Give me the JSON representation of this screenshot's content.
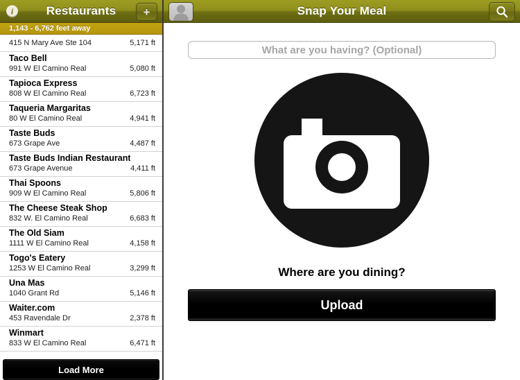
{
  "left_panel": {
    "navbar": {
      "title": "Restaurants",
      "info_icon_glyph": "i",
      "add_button_label": "+"
    },
    "section_header": "1,143 - 6,762 feet away",
    "rows": [
      {
        "title": "",
        "address": "415 N Mary Ave Ste 104",
        "distance": "5,171 ft"
      },
      {
        "title": "Taco Bell",
        "address": "991 W El Camino Real",
        "distance": "5,080 ft"
      },
      {
        "title": "Tapioca Express",
        "address": "808 W El Camino Real",
        "distance": "6,723 ft"
      },
      {
        "title": "Taqueria Margaritas",
        "address": "80 W El Camino Real",
        "distance": "4,941 ft"
      },
      {
        "title": "Taste Buds",
        "address": "673 Grape Ave",
        "distance": "4,487 ft"
      },
      {
        "title": "Taste Buds Indian Restaurant",
        "address": "673 Grape Avenue",
        "distance": "4,411 ft"
      },
      {
        "title": "Thai Spoons",
        "address": "909 W El Camino Real",
        "distance": "5,806 ft"
      },
      {
        "title": "The Cheese Steak Shop",
        "address": "832 W. El Camino Real",
        "distance": "6,683 ft"
      },
      {
        "title": "The Old Siam",
        "address": "1111 W El Camino Real",
        "distance": "4,158 ft"
      },
      {
        "title": "Togo's Eatery",
        "address": "1253 W El Camino Real",
        "distance": "3,299 ft"
      },
      {
        "title": "Una Mas",
        "address": "1040 Grant Rd",
        "distance": "5,146 ft"
      },
      {
        "title": "Waiter.com",
        "address": "453 Ravendale Dr",
        "distance": "2,378 ft"
      },
      {
        "title": "Winmart",
        "address": "833 W El Camino Real",
        "distance": "6,471 ft"
      }
    ],
    "load_more_label": "Load More"
  },
  "right_panel": {
    "navbar": {
      "title": "Snap Your Meal",
      "avatar_icon": "person-avatar-icon",
      "search_icon": "search-icon"
    },
    "meal_input": {
      "value": "",
      "placeholder": "What are you having? (Optional)"
    },
    "camera_icon": "camera-icon",
    "dining_prompt": "Where are you dining?",
    "upload_label": "Upload"
  },
  "colors": {
    "navbar_top": "#9d9d22",
    "navbar_bottom": "#5e5e11",
    "section_header": "#b5950d",
    "button_black": "#000000",
    "text_primary": "#000000",
    "placeholder_gray": "#a6a6a6"
  }
}
